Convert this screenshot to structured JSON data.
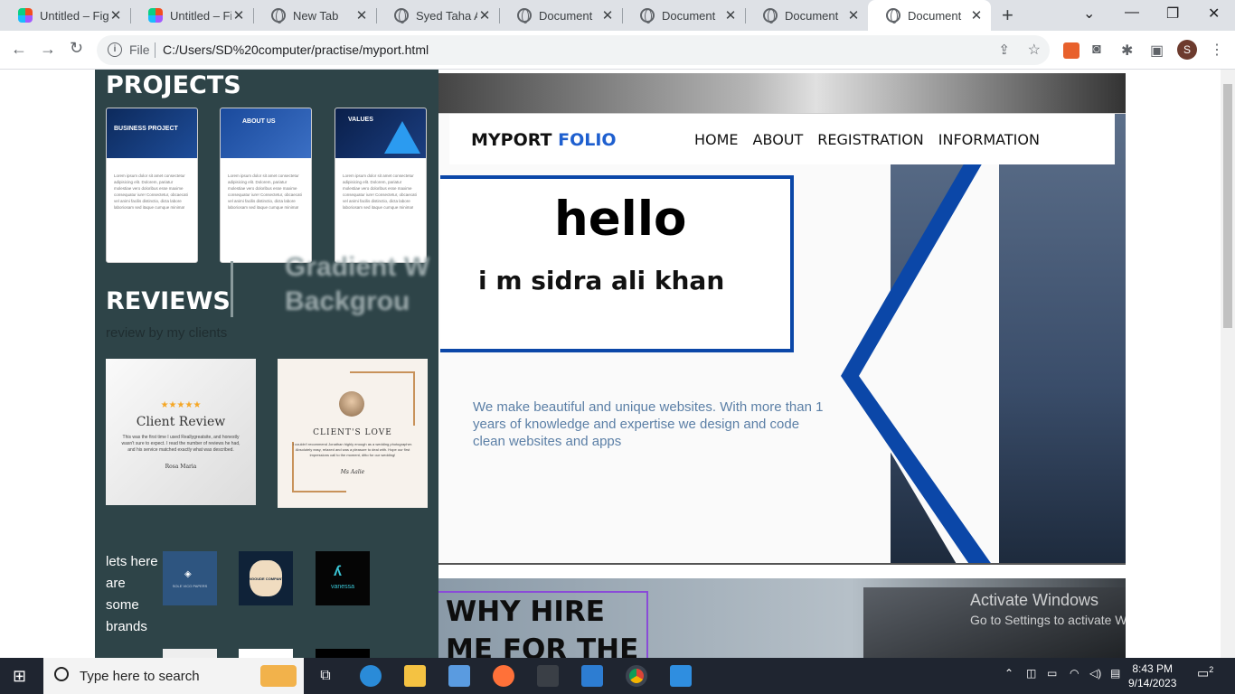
{
  "browser": {
    "tabs": [
      {
        "title": "Untitled – Fig",
        "icon": "figma-icon",
        "active": false
      },
      {
        "title": "Untitled – Fig",
        "icon": "figma-icon",
        "active": false
      },
      {
        "title": "New Tab",
        "icon": "chrome-icon",
        "active": false
      },
      {
        "title": "Syed Taha Ali",
        "icon": "globe-icon",
        "active": false
      },
      {
        "title": "Document",
        "icon": "globe-icon",
        "active": false
      },
      {
        "title": "Document",
        "icon": "globe-icon",
        "active": false
      },
      {
        "title": "Document",
        "icon": "globe-icon",
        "active": false
      },
      {
        "title": "Document",
        "icon": "globe-icon",
        "active": true
      }
    ],
    "address_label": "File",
    "url": "C:/Users/SD%20computer/practise/myport.html",
    "profile_initial": "S"
  },
  "sidebar": {
    "projects_title": "PROJECTS",
    "projects": [
      {
        "image_label": "BUSINESS PROJECT",
        "text": "Lorem ipsum dolor sit amet consectetur adipisicing elit. Dolorem, pariatur molestiae vero doloribus esse maxime consequatur iure! Consectetur, obcaecati vel animi facilis distinctio, dicta labore laboriosam sed itaque cumque minima!"
      },
      {
        "image_label": "ABOUT US",
        "text": "Lorem ipsum dolor sit amet consectetur adipisicing elit. Dolorem, pariatur molestiae vero doloribus esse maxime consequatur iure! Consectetur, obcaecati vel animi facilis distinctio, dicta labore laboriosam sed itaque cumque minima!"
      },
      {
        "image_label": "VALUES",
        "text": "Lorem ipsum dolor sit amet consectetur adipisicing elit. Dolorem, pariatur molestiae vero doloribus esse maxime consequatur iure! Consectetur, obcaecati vel animi facilis distinctio, dicta labore laboriosam sed itaque cumque minima!"
      }
    ],
    "ghost_text_1": "Gradient W",
    "ghost_text_2": "Backgrou",
    "reviews_title": "REVIEWS",
    "reviews_subtitle": "review by my clients",
    "review_cards": [
      {
        "stars": "★★★★★",
        "heading": "Client Review",
        "body": "This was the first time I used Reallygreatsite, and honestly wasn't sure to expect. I read the number of reviews he had, and his service matched exactly what was described.",
        "signature": "Rosa Maria"
      },
      {
        "heading": "CLIENT'S LOVE",
        "body": "I couldn't recommend Jonathan highly enough as a wedding photographer. Absolutely easy, relaxed and was a pleasure to deal with. Hope our first impressions call to the moment, ditto for our wedding!",
        "signature": "Ms Aalie"
      }
    ],
    "brands_text": "lets here are some brands",
    "brands": [
      {
        "name": "SOLE VICO PAPERS",
        "color": "#2e5580"
      },
      {
        "name": "INGOUDE COMPANY",
        "color": "#0f2238"
      },
      {
        "name": "vanessa",
        "color": "#050505"
      }
    ]
  },
  "main": {
    "logo_part1": "MYPORT",
    "logo_part2": "FOLIO",
    "nav": [
      "HOME",
      "ABOUT",
      "REGISTRATION",
      "INFORMATION"
    ],
    "hello": "hello",
    "name": "i m sidra ali khan",
    "description": "We make beautiful and unique  websites. With more than 1 years of knowledge and expertise we design and code clean websites and apps",
    "why_title": "WHY HIRE ME FOR THE NEXT"
  },
  "windows": {
    "watermark_title": "Activate Windows",
    "watermark_sub": "Go to Settings to activate Windows.",
    "search_placeholder": "Type here to search",
    "time": "8:43 PM",
    "date": "9/14/2023",
    "notification_count": "2"
  },
  "colors": {
    "accent": "#1e5fcf",
    "sidebar_bg": "#2e4448",
    "hero_border": "#0b47a8"
  }
}
